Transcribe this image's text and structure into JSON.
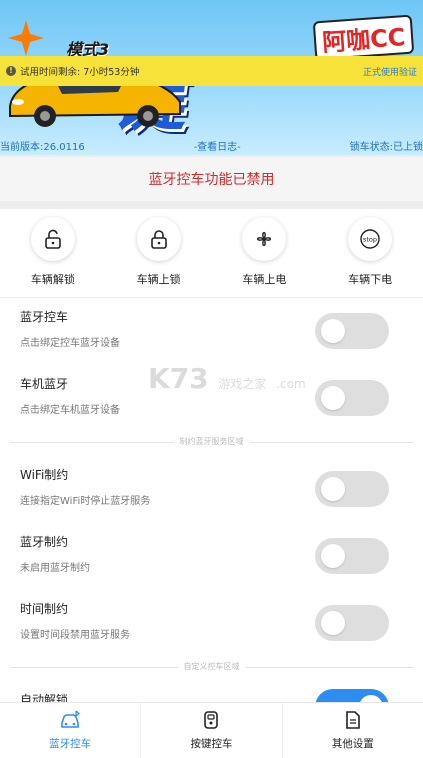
{
  "banner": {
    "mode_text": "模式3",
    "brand_text": "阿咖CC"
  },
  "trial": {
    "remaining_text": "试用时间剩余: 7小时53分钟",
    "official_link": "正式使用验证"
  },
  "version_row": {
    "version": "当前版本:26.0116",
    "view_log": "-查看日志-",
    "lock_status": "锁车状态:已上锁"
  },
  "status_message": "蓝牙控车功能已禁用",
  "actions": [
    {
      "label": "车辆解锁",
      "icon": "unlock-icon"
    },
    {
      "label": "车辆上锁",
      "icon": "lock-icon"
    },
    {
      "label": "车辆上电",
      "icon": "fan-icon"
    },
    {
      "label": "车辆下电",
      "icon": "stop-icon"
    }
  ],
  "stop_icon_text": "stop",
  "settings": {
    "bluetooth_control": {
      "title": "蓝牙控车",
      "sub": "点击绑定控车蓝牙设备",
      "on": false
    },
    "head_unit_bluetooth": {
      "title": "车机蓝牙",
      "sub": "点击绑定车机蓝牙设备",
      "on": false
    },
    "section_restrict": "制约蓝牙服务区域",
    "wifi_restrict": {
      "title": "WiFi制约",
      "sub": "连接指定WiFi时停止蓝牙服务",
      "on": false
    },
    "bluetooth_restrict": {
      "title": "蓝牙制约",
      "sub": "未启用蓝牙制约",
      "on": false
    },
    "time_restrict": {
      "title": "时间制约",
      "sub": "设置时间段禁用蓝牙服务",
      "on": false
    },
    "section_custom": "自定义控车区域",
    "auto_unlock": {
      "title": "自动解锁",
      "on": true
    }
  },
  "tabs": [
    {
      "label": "蓝牙控车",
      "active": true
    },
    {
      "label": "按键控车",
      "active": false
    },
    {
      "label": "其他设置",
      "active": false
    }
  ],
  "watermark": {
    "main": "K73",
    "sub": "游戏之家",
    "domain": ".com"
  },
  "colors": {
    "accent": "#2b8ef0",
    "warning": "#d12b2b",
    "trial_bar": "#f7e23a",
    "link": "#1f6fc6"
  }
}
